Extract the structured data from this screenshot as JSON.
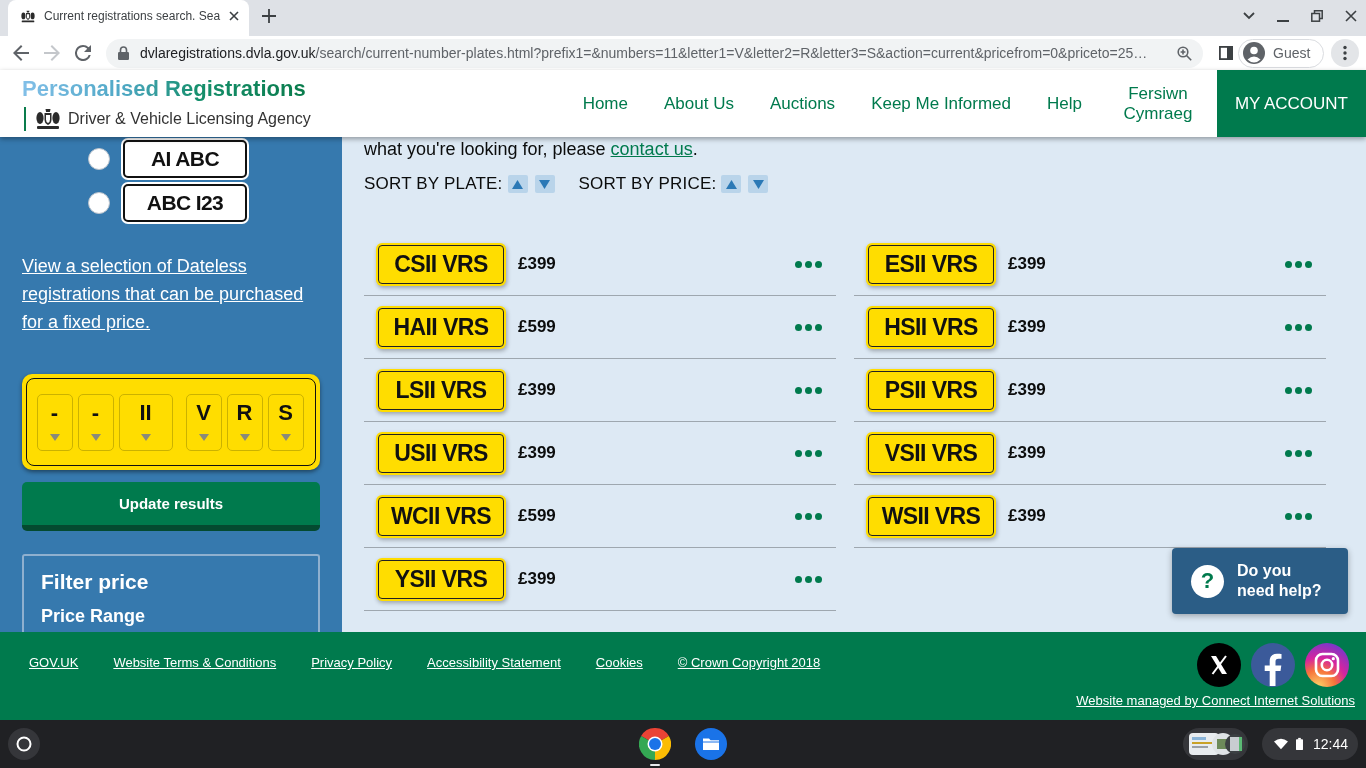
{
  "browser": {
    "tab": {
      "title": "Current registrations search. Sea"
    },
    "toolbar": [
      {
        "kind": "back",
        "disabled": false
      },
      {
        "kind": "forward",
        "disabled": true
      },
      {
        "kind": "reload",
        "disabled": false
      }
    ],
    "address": {
      "host": "dvlaregistrations.dvla.gov.uk",
      "path": "/search/current-number-plates.html?prefix1=&numbers=11&letter1=V&letter2=R&letter3=S&action=current&pricefrom=0&priceto=25…"
    },
    "profile": "Guest"
  },
  "header": {
    "title": "Personalised Registrations",
    "subtitle": "Driver & Vehicle Licensing Agency",
    "nav": [
      {
        "label": "Home"
      },
      {
        "label": "About Us"
      },
      {
        "label": "Auctions"
      },
      {
        "label": "Keep Me Informed"
      },
      {
        "label": "Help"
      },
      {
        "label": "Fersiwn Cymraeg"
      }
    ],
    "account_button": "MY ACCOUNT"
  },
  "sidebar": {
    "plate_styles": [
      {
        "plate": "AI ABC",
        "selected": false
      },
      {
        "plate": "ABC I23",
        "selected": false
      }
    ],
    "dateless_link": "View a selection of Dateless registrations that can be purchased for a fixed price.",
    "plate_selector": {
      "groups": [
        {
          "slots": [
            {
              "kind": "letter",
              "value": "-"
            },
            {
              "kind": "letter",
              "value": "-"
            },
            {
              "kind": "number",
              "value": "II"
            }
          ]
        },
        {
          "slots": [
            {
              "kind": "letter",
              "value": "V"
            },
            {
              "kind": "letter",
              "value": "R"
            },
            {
              "kind": "letter",
              "value": "S"
            }
          ]
        }
      ]
    },
    "update_button": "Update results",
    "filter": {
      "title": "Filter price",
      "subtitle": "Price Range"
    }
  },
  "results": {
    "intro": {
      "text": "what you're looking for, please ",
      "link": "contact us",
      "end": "."
    },
    "sort": [
      {
        "label": "SORT BY PLATE:"
      },
      {
        "label": "SORT BY PRICE:"
      }
    ],
    "plates": [
      {
        "plate": "CSII VRS",
        "price": "£399"
      },
      {
        "plate": "ESII VRS",
        "price": "£399"
      },
      {
        "plate": "HAII VRS",
        "price": "£599"
      },
      {
        "plate": "HSII VRS",
        "price": "£399"
      },
      {
        "plate": "LSII VRS",
        "price": "£399"
      },
      {
        "plate": "PSII VRS",
        "price": "£399"
      },
      {
        "plate": "USII VRS",
        "price": "£399"
      },
      {
        "plate": "VSII VRS",
        "price": "£399"
      },
      {
        "plate": "WCII VRS",
        "price": "£599"
      },
      {
        "plate": "WSII VRS",
        "price": "£399"
      },
      {
        "plate": "YSII VRS",
        "price": "£399"
      }
    ]
  },
  "help_widget": {
    "icon": "?",
    "label": "Do you need help?"
  },
  "footer": {
    "links": [
      "GOV.UK",
      "Website Terms & Conditions",
      "Privacy Policy",
      "Accessibility Statement",
      "Cookies",
      "© Crown Copyright 2018"
    ],
    "social": [
      {
        "kind": "x"
      },
      {
        "kind": "facebook"
      },
      {
        "kind": "instagram"
      }
    ],
    "managed_by": "Website managed by Connect Internet Solutions"
  },
  "taskbar": {
    "apps": [
      {
        "kind": "browser",
        "running": true
      },
      {
        "kind": "files",
        "running": false
      }
    ],
    "time": "12:44"
  }
}
